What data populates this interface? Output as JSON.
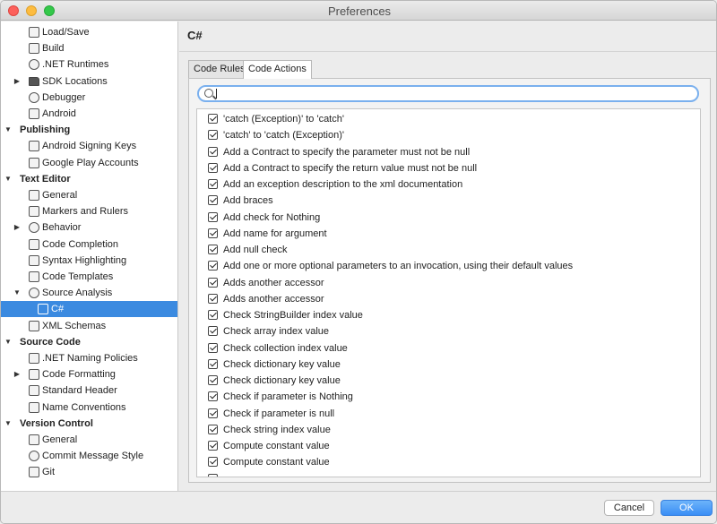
{
  "window": {
    "title": "Preferences"
  },
  "sidebar": {
    "items": [
      {
        "label": "Load/Save",
        "level": 1,
        "icon": "disk-icon"
      },
      {
        "label": "Build",
        "level": 1,
        "icon": "build-icon"
      },
      {
        "label": ".NET Runtimes",
        "level": 1,
        "icon": "gear-icon"
      },
      {
        "label": "SDK Locations",
        "level": 1,
        "icon": "folder-icon",
        "expandable": true
      },
      {
        "label": "Debugger",
        "level": 1,
        "icon": "bug-icon"
      },
      {
        "label": "Android",
        "level": 1,
        "icon": "android-icon"
      },
      {
        "label": "Publishing",
        "level": 0,
        "header": true
      },
      {
        "label": "Android Signing Keys",
        "level": 1,
        "icon": "key-icon"
      },
      {
        "label": "Google Play Accounts",
        "level": 1,
        "icon": "play-icon"
      },
      {
        "label": "Text Editor",
        "level": 0,
        "header": true
      },
      {
        "label": "General",
        "level": 1,
        "icon": "edit-icon"
      },
      {
        "label": "Markers and Rulers",
        "level": 1,
        "icon": "ruler-icon"
      },
      {
        "label": "Behavior",
        "level": 1,
        "icon": "brain-icon",
        "expandable": true
      },
      {
        "label": "Code Completion",
        "level": 1,
        "icon": "completion-icon"
      },
      {
        "label": "Syntax Highlighting",
        "level": 1,
        "icon": "highlight-icon"
      },
      {
        "label": "Code Templates",
        "level": 1,
        "icon": "template-icon"
      },
      {
        "label": "Source Analysis",
        "level": 1,
        "icon": "analysis-icon",
        "expanded": true
      },
      {
        "label": "C#",
        "level": 2,
        "icon": "braces-icon",
        "selected": true
      },
      {
        "label": "XML Schemas",
        "level": 1,
        "icon": "xml-icon"
      },
      {
        "label": "Source Code",
        "level": 0,
        "header": true
      },
      {
        "label": ".NET Naming Policies",
        "level": 1,
        "icon": "naming-icon"
      },
      {
        "label": "Code Formatting",
        "level": 1,
        "icon": "format-icon",
        "expandable": true
      },
      {
        "label": "Standard Header",
        "level": 1,
        "icon": "hash-icon"
      },
      {
        "label": "Name Conventions",
        "level": 1,
        "icon": "naming-icon"
      },
      {
        "label": "Version Control",
        "level": 0,
        "header": true
      },
      {
        "label": "General",
        "level": 1,
        "icon": "branch-icon"
      },
      {
        "label": "Commit Message Style",
        "level": 1,
        "icon": "commit-icon"
      },
      {
        "label": "Git",
        "level": 1,
        "icon": "git-icon"
      }
    ]
  },
  "main": {
    "title": "C#",
    "tabs": [
      {
        "label": "Code Rules",
        "active": false
      },
      {
        "label": "Code Actions",
        "active": true
      }
    ],
    "search": {
      "value": "",
      "placeholder": ""
    },
    "actions": [
      {
        "label": "'catch (Exception)' to 'catch'",
        "checked": true
      },
      {
        "label": "'catch' to 'catch (Exception)'",
        "checked": true
      },
      {
        "label": "Add a Contract to specify the parameter must not be null",
        "checked": true
      },
      {
        "label": "Add a Contract to specify the return value must not be null",
        "checked": true
      },
      {
        "label": "Add an exception description to the xml documentation",
        "checked": true
      },
      {
        "label": "Add braces",
        "checked": true
      },
      {
        "label": "Add check for Nothing",
        "checked": true
      },
      {
        "label": "Add name for argument",
        "checked": true
      },
      {
        "label": "Add null check",
        "checked": true
      },
      {
        "label": "Add one or more optional parameters to an invocation, using their default values",
        "checked": true
      },
      {
        "label": "Adds another accessor",
        "checked": true
      },
      {
        "label": "Adds another accessor",
        "checked": true
      },
      {
        "label": "Check StringBuilder index value",
        "checked": true
      },
      {
        "label": "Check array index value",
        "checked": true
      },
      {
        "label": "Check collection index value",
        "checked": true
      },
      {
        "label": "Check dictionary key value",
        "checked": true
      },
      {
        "label": "Check dictionary key value",
        "checked": true
      },
      {
        "label": "Check if parameter is Nothing",
        "checked": true
      },
      {
        "label": "Check if parameter is null",
        "checked": true
      },
      {
        "label": "Check string index value",
        "checked": true
      },
      {
        "label": "Compute constant value",
        "checked": true
      },
      {
        "label": "Compute constant value",
        "checked": true
      },
      {
        "label": "",
        "checked": true
      }
    ]
  },
  "footer": {
    "cancel_label": "Cancel",
    "ok_label": "OK"
  },
  "colors": {
    "selection": "#3b8ae0",
    "ok_button": "#3a8ef5",
    "search_focus": "#7ab0ee"
  }
}
